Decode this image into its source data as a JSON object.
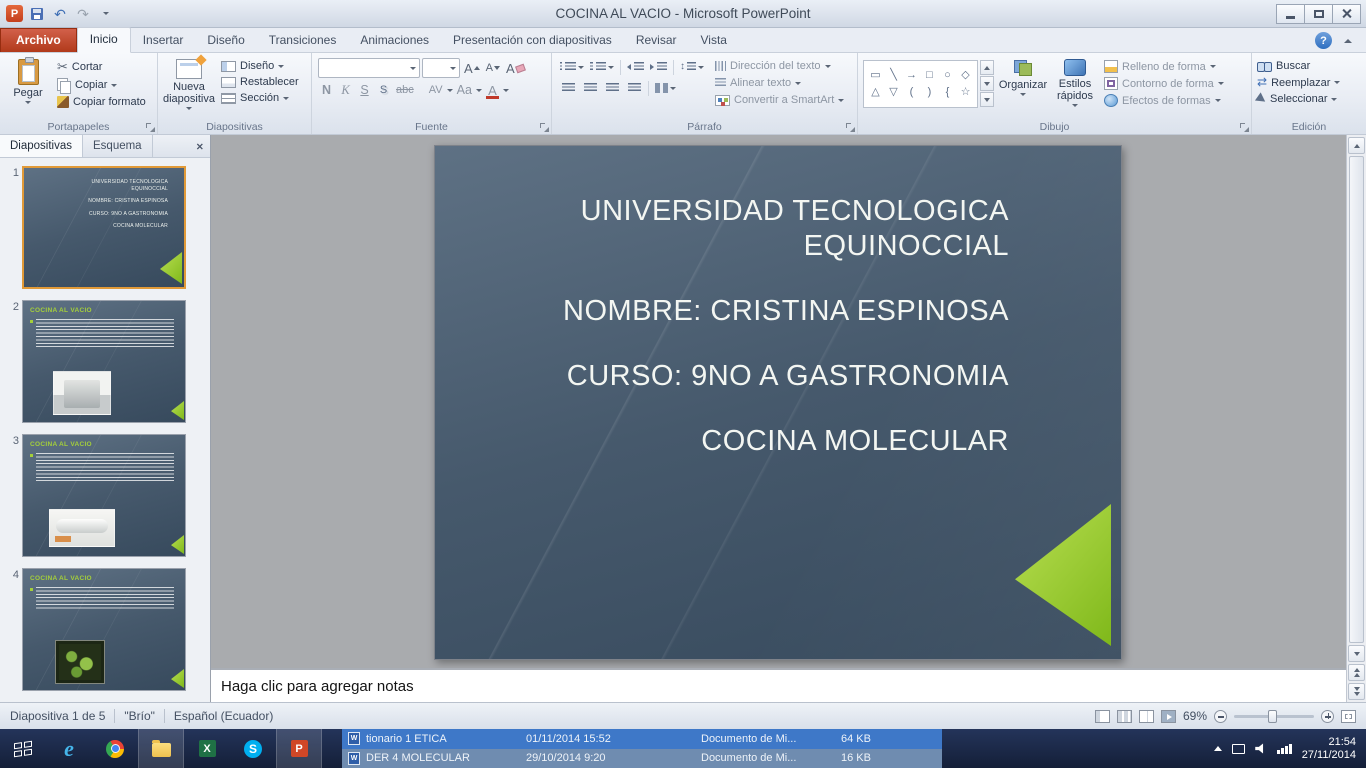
{
  "titlebar": {
    "title": "COCINA AL VACIO  -  Microsoft PowerPoint"
  },
  "ribbon_tabs": {
    "file": "Archivo",
    "items": [
      "Inicio",
      "Insertar",
      "Diseño",
      "Transiciones",
      "Animaciones",
      "Presentación con diapositivas",
      "Revisar",
      "Vista"
    ]
  },
  "clipboard": {
    "label": "Portapapeles",
    "paste": "Pegar",
    "cut": "Cortar",
    "copy": "Copiar",
    "format_painter": "Copiar formato"
  },
  "slides_group": {
    "label": "Diapositivas",
    "new_slide": "Nueva diapositiva",
    "layout": "Diseño",
    "reset": "Restablecer",
    "section": "Sección"
  },
  "font_group": {
    "label": "Fuente",
    "bold": "N",
    "italic": "K",
    "underline": "S",
    "shadow": "S",
    "strike": "abc",
    "spacing": "AV",
    "case": "Aa",
    "color": "A"
  },
  "paragraph_group": {
    "label": "Párrafo",
    "text_direction": "Dirección del texto",
    "align_text": "Alinear texto",
    "smartart": "Convertir a SmartArt"
  },
  "drawing_group": {
    "label": "Dibujo",
    "arrange": "Organizar",
    "quick_styles": "Estilos rápidos",
    "shape_fill": "Relleno de forma",
    "shape_outline": "Contorno de forma",
    "shape_effects": "Efectos de formas"
  },
  "editing_group": {
    "label": "Edición",
    "find": "Buscar",
    "replace": "Reemplazar",
    "select": "Seleccionar"
  },
  "slides_panel": {
    "tab_slides": "Diapositivas",
    "tab_outline": "Esquema",
    "thumb_title": "COCINA AL VACIO",
    "numbers": [
      "1",
      "2",
      "3",
      "4"
    ]
  },
  "slide": {
    "line1": "UNIVERSIDAD TECNOLOGICA",
    "line2": "EQUINOCCIAL",
    "line3": "NOMBRE: CRISTINA ESPINOSA",
    "line4": "CURSO: 9NO A GASTRONOMIA",
    "line5": "COCINA MOLECULAR"
  },
  "notes": {
    "placeholder": "Haga clic para agregar notas"
  },
  "statusbar": {
    "slide_info": "Diapositiva 1 de 5",
    "theme": "\"Brío\"",
    "language": "Español (Ecuador)",
    "zoom_level": "69%"
  },
  "taskbar": {
    "files": [
      {
        "name": "tionario 1 ETICA",
        "date": "01/11/2014 15:52",
        "type": "Documento de Mi...",
        "size": "64 KB"
      },
      {
        "name": "DER 4 MOLECULAR",
        "date": "29/10/2014 9:20",
        "type": "Documento de Mi...",
        "size": "16 KB"
      }
    ],
    "time": "21:54",
    "date": "27/11/2014"
  }
}
